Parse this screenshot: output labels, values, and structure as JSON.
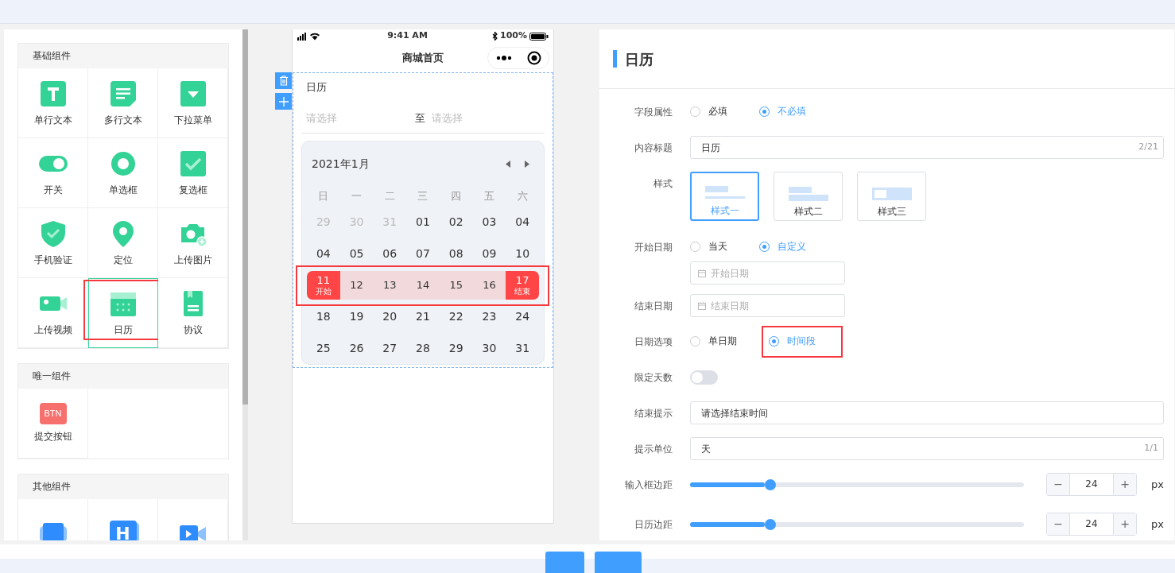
{
  "palette": {
    "sections": [
      {
        "title": "基础组件",
        "items": [
          {
            "label": "单行文本",
            "selected": false,
            "annotated": false
          },
          {
            "label": "多行文本",
            "selected": false,
            "annotated": false
          },
          {
            "label": "下拉菜单",
            "selected": false,
            "annotated": false
          },
          {
            "label": "开关",
            "selected": false,
            "annotated": false
          },
          {
            "label": "单选框",
            "selected": false,
            "annotated": false
          },
          {
            "label": "复选框",
            "selected": false,
            "annotated": false
          },
          {
            "label": "手机验证",
            "selected": false,
            "annotated": false
          },
          {
            "label": "定位",
            "selected": false,
            "annotated": false
          },
          {
            "label": "上传图片",
            "selected": false,
            "annotated": false
          },
          {
            "label": "上传视频",
            "selected": false,
            "annotated": false
          },
          {
            "label": "日历",
            "selected": true,
            "annotated": true
          },
          {
            "label": "协议",
            "selected": false,
            "annotated": false
          }
        ]
      },
      {
        "title": "唯一组件",
        "items": [
          {
            "label": "提交按钮",
            "icon_text": "BTN",
            "selected": false,
            "annotated": false
          }
        ]
      },
      {
        "title": "其他组件",
        "items": [
          {
            "selected": false,
            "annotated": false
          },
          {
            "icon_text": "H",
            "selected": false,
            "annotated": false
          },
          {
            "selected": false,
            "annotated": false
          }
        ]
      }
    ]
  },
  "phone": {
    "time": "9:41 AM",
    "battery": "100%",
    "title": "商城首页",
    "field_label": "日历",
    "start_placeholder": "请选择",
    "separator": "至",
    "end_placeholder": "请选择",
    "calendar": {
      "month": "2021年1月",
      "weekdays": [
        "日",
        "一",
        "二",
        "三",
        "四",
        "五",
        "六"
      ],
      "weeks": [
        {
          "annotated": false,
          "days": [
            {
              "text": "29",
              "kind": "outside"
            },
            {
              "text": "30",
              "kind": "outside"
            },
            {
              "text": "31",
              "kind": "outside"
            },
            {
              "text": "01",
              "kind": "normal"
            },
            {
              "text": "02",
              "kind": "normal"
            },
            {
              "text": "03",
              "kind": "normal"
            },
            {
              "text": "04",
              "kind": "normal"
            }
          ]
        },
        {
          "annotated": false,
          "days": [
            {
              "text": "04",
              "kind": "normal"
            },
            {
              "text": "05",
              "kind": "normal"
            },
            {
              "text": "06",
              "kind": "normal"
            },
            {
              "text": "07",
              "kind": "normal"
            },
            {
              "text": "08",
              "kind": "normal"
            },
            {
              "text": "09",
              "kind": "normal"
            },
            {
              "text": "10",
              "kind": "normal"
            }
          ]
        },
        {
          "annotated": true,
          "days": [
            {
              "text": "11",
              "kind": "start",
              "note": "开始"
            },
            {
              "text": "12",
              "kind": "in_range"
            },
            {
              "text": "13",
              "kind": "in_range"
            },
            {
              "text": "14",
              "kind": "in_range"
            },
            {
              "text": "15",
              "kind": "in_range"
            },
            {
              "text": "16",
              "kind": "in_range"
            },
            {
              "text": "17",
              "kind": "end",
              "note": "结束"
            }
          ]
        },
        {
          "annotated": false,
          "days": [
            {
              "text": "18",
              "kind": "normal"
            },
            {
              "text": "19",
              "kind": "normal"
            },
            {
              "text": "20",
              "kind": "normal"
            },
            {
              "text": "21",
              "kind": "normal"
            },
            {
              "text": "22",
              "kind": "normal"
            },
            {
              "text": "23",
              "kind": "normal"
            },
            {
              "text": "24",
              "kind": "normal"
            }
          ]
        },
        {
          "annotated": false,
          "days": [
            {
              "text": "25",
              "kind": "normal"
            },
            {
              "text": "26",
              "kind": "normal"
            },
            {
              "text": "27",
              "kind": "normal"
            },
            {
              "text": "28",
              "kind": "normal"
            },
            {
              "text": "29",
              "kind": "normal"
            },
            {
              "text": "30",
              "kind": "normal"
            },
            {
              "text": "31",
              "kind": "normal"
            }
          ]
        }
      ]
    }
  },
  "settings": {
    "title": "日历",
    "rows": [
      {
        "kind": "radio",
        "label": "字段属性",
        "options": [
          {
            "label": "必填",
            "selected": false
          },
          {
            "label": "不必填",
            "selected": true
          }
        ]
      },
      {
        "kind": "text",
        "label": "内容标题",
        "value": "日历",
        "count": "2/21"
      },
      {
        "kind": "styles",
        "label": "样式",
        "options": [
          {
            "label": "样式一",
            "selected": true
          },
          {
            "label": "样式二",
            "selected": false
          },
          {
            "label": "样式三",
            "selected": false
          }
        ]
      },
      {
        "kind": "radio",
        "label": "开始日期",
        "options": [
          {
            "label": "当天",
            "selected": false
          },
          {
            "label": "自定义",
            "selected": true
          }
        ],
        "date_placeholder": "开始日期"
      },
      {
        "kind": "date",
        "label": "结束日期",
        "date_placeholder": "结束日期"
      },
      {
        "kind": "radio",
        "label": "日期选项",
        "options": [
          {
            "label": "单日期",
            "selected": false
          },
          {
            "label": "时间段",
            "selected": true,
            "annotated": true
          }
        ]
      },
      {
        "kind": "toggle",
        "label": "限定天数",
        "on": false
      },
      {
        "kind": "text",
        "label": "结束提示",
        "value": "请选择结束时间"
      },
      {
        "kind": "text",
        "label": "提示单位",
        "value": "天",
        "count": "1/1"
      },
      {
        "kind": "slider",
        "label": "输入框边距",
        "level": 0.24,
        "decrement": "−",
        "value": "24",
        "increment": "+",
        "unit": "px"
      },
      {
        "kind": "slider",
        "label": "日历边距",
        "level": 0.24,
        "decrement": "−",
        "value": "24",
        "increment": "+",
        "unit": "px"
      }
    ]
  }
}
